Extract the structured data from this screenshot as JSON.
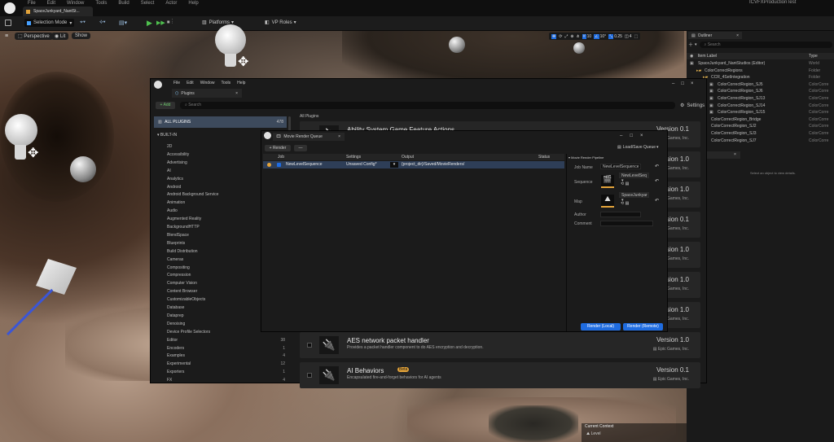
{
  "menu": [
    "File",
    "Edit",
    "Window",
    "Tools",
    "Build",
    "Select",
    "Actor",
    "Help"
  ],
  "project_badge": "ICVFXProductionTest",
  "level_tab": "SpaceJunkyard_NantSt...",
  "toolbar": {
    "selection_mode": "Selection Mode",
    "platforms": "Platforms",
    "vp_roles": "VP Roles"
  },
  "viewport": {
    "perspective": "Perspective",
    "lit": "Lit",
    "show": "Show",
    "snap_angle": "10°",
    "snap_scale": "0.25",
    "cam_speed": "4",
    "grid": "10"
  },
  "outliner": {
    "tab": "Outliner",
    "search_placeholder": "Search",
    "col_label": "Item Label",
    "col_type": "Type",
    "rows": [
      {
        "label": "SpaceJunkyard_NantStudios (Editor)",
        "type": "World",
        "indent": 4
      },
      {
        "label": "ColorCorrectRegions",
        "type": "Folder",
        "indent": 12
      },
      {
        "label": "CCR_4SetIntegration",
        "type": "Folder",
        "indent": 20
      },
      {
        "label": "ColorCorrectRegion_SJ5",
        "type": "ColorCorre",
        "indent": 28
      },
      {
        "label": "ColorCorrectRegion_SJ6",
        "type": "ColorCorre",
        "indent": 28
      },
      {
        "label": "ColorCorrectRegion_SJ13",
        "type": "ColorCorre",
        "indent": 28
      },
      {
        "label": "ColorCorrectRegion_SJ14",
        "type": "ColorCorre",
        "indent": 28
      },
      {
        "label": "ColorCorrectRegion_SJ15",
        "type": "ColorCorre",
        "indent": 28
      },
      {
        "label": "ColorCorrectRegion_Bridge",
        "type": "ColorCorre",
        "indent": 20
      },
      {
        "label": "ColorCorrectRegion_SJ2",
        "type": "ColorCorre",
        "indent": 20
      },
      {
        "label": "ColorCorrectRegion_SJ3",
        "type": "ColorCorre",
        "indent": 20
      },
      {
        "label": "ColorCorrectRegion_SJ7",
        "type": "ColorCorre",
        "indent": 20
      }
    ],
    "details_empty": "Select an object to view details."
  },
  "plugins": {
    "menu": [
      "File",
      "Edit",
      "Window",
      "Tools",
      "Help"
    ],
    "tab": "Plugins",
    "add": "+ Add",
    "search_placeholder": "Search",
    "settings": "Settings",
    "all_plugins": "ALL PLUGINS",
    "all_count": "478",
    "built_in": "BUILT-IN",
    "breadcrumb": "All Plugins",
    "categories": [
      {
        "name": "2D",
        "count": ""
      },
      {
        "name": "Accessibility",
        "count": ""
      },
      {
        "name": "Advertising",
        "count": ""
      },
      {
        "name": "AI",
        "count": ""
      },
      {
        "name": "Analytics",
        "count": ""
      },
      {
        "name": "Android",
        "count": ""
      },
      {
        "name": "Android Background Service",
        "count": ""
      },
      {
        "name": "Animation",
        "count": ""
      },
      {
        "name": "Audio",
        "count": ""
      },
      {
        "name": "Augmented Reality",
        "count": ""
      },
      {
        "name": "BackgroundHTTP",
        "count": ""
      },
      {
        "name": "BlendSpace",
        "count": ""
      },
      {
        "name": "Blueprints",
        "count": ""
      },
      {
        "name": "Build Distribution",
        "count": ""
      },
      {
        "name": "Cameras",
        "count": ""
      },
      {
        "name": "Compositing",
        "count": ""
      },
      {
        "name": "Compression",
        "count": ""
      },
      {
        "name": "Computer Vision",
        "count": ""
      },
      {
        "name": "Content Browser",
        "count": ""
      },
      {
        "name": "CustomizableObjects",
        "count": ""
      },
      {
        "name": "Database",
        "count": ""
      },
      {
        "name": "Dataprep",
        "count": ""
      },
      {
        "name": "Denoising",
        "count": ""
      },
      {
        "name": "Device Profile Selectors",
        "count": ""
      },
      {
        "name": "Editor",
        "count": "38"
      },
      {
        "name": "Encoders",
        "count": "1"
      },
      {
        "name": "Examples",
        "count": "4"
      },
      {
        "name": "Experimental",
        "count": "12"
      },
      {
        "name": "Exporters",
        "count": "1"
      },
      {
        "name": "FX",
        "count": "4"
      }
    ],
    "cards": [
      {
        "title": "Ability System Game Feature Actions",
        "desc": "",
        "version": "Version 0.1",
        "vendor": "Epic Games, Inc."
      },
      {
        "title": "",
        "desc": "",
        "version": "Version 1.0",
        "vendor": "Epic Games, Inc."
      },
      {
        "title": "",
        "desc": "",
        "version": "Version 1.0",
        "vendor": "Epic Games, Inc."
      },
      {
        "title": "",
        "desc": "",
        "version": "Version 0.1",
        "vendor": "Epic Games, Inc."
      },
      {
        "title": "",
        "desc": "",
        "version": "Version 1.0",
        "vendor": "Epic Games, Inc."
      },
      {
        "title": "",
        "desc": "",
        "version": "Version 1.0",
        "vendor": "Epic Games, Inc."
      },
      {
        "title": "",
        "desc": "",
        "version": "Version 1.0",
        "vendor": "Epic Games, Inc."
      },
      {
        "title": "AES network packet handler",
        "desc": "Provides a packet handler component to do AES encryption and decryption.",
        "version": "Version 1.0",
        "vendor": "Epic Games, Inc."
      },
      {
        "title": "AI Behaviors",
        "desc": "Encapsulated fire-and-forget behaviors for AI agents",
        "version": "Version 0.1",
        "vendor": "Epic Games, Inc.",
        "badge": "Beta"
      }
    ]
  },
  "mrq": {
    "title": "Movie Render Queue",
    "render_btn": "+ Render",
    "minus_btn": "—",
    "load_save": "Load/Save Queue",
    "cols": {
      "job": "Job",
      "settings": "Settings",
      "output": "Output",
      "status": "Status"
    },
    "job": {
      "name": "NewLevelSequence",
      "settings": "Unsaved Config*",
      "output": "{project_dir}/Saved/MovieRenders/"
    },
    "panel_title": "Movie Render Pipeline",
    "job_name_label": "Job Name",
    "job_name_value": "NewLevelSequence",
    "sequence_label": "Sequence",
    "sequence_value": "NewLevelSeq",
    "map_label": "Map",
    "map_value": "SpaceJunkyar",
    "author_label": "Author",
    "comment_label": "Comment",
    "render_local": "Render (Local)",
    "render_remote": "Render (Remote)"
  },
  "status": {
    "current_context": "Current Context",
    "level": "Level"
  }
}
